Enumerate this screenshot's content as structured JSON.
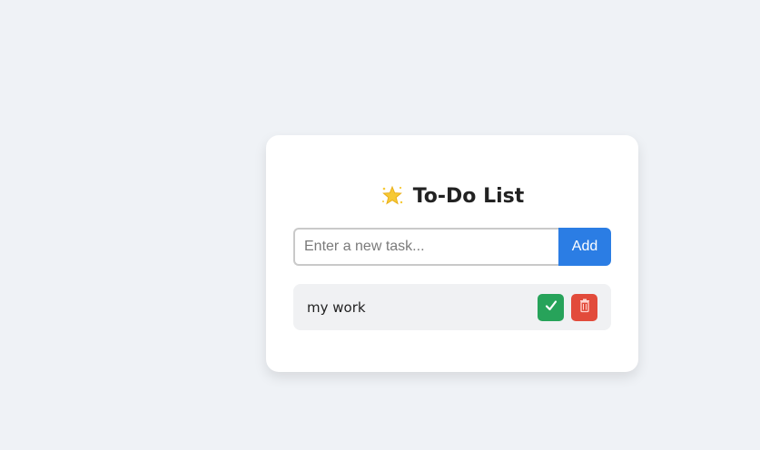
{
  "app": {
    "title": "To-Do List",
    "title_icon": "glowing-star-icon"
  },
  "new_task": {
    "placeholder": "Enter a new task...",
    "value": "",
    "add_label": "Add"
  },
  "tasks": [
    {
      "label": "my work",
      "complete_icon": "check-icon",
      "delete_icon": "trash-icon"
    }
  ],
  "colors": {
    "background": "#eff2f6",
    "card": "#ffffff",
    "accent": "#2b7de4",
    "complete": "#27a35a",
    "delete": "#e24b3b",
    "task_bg": "#f0f1f3"
  }
}
